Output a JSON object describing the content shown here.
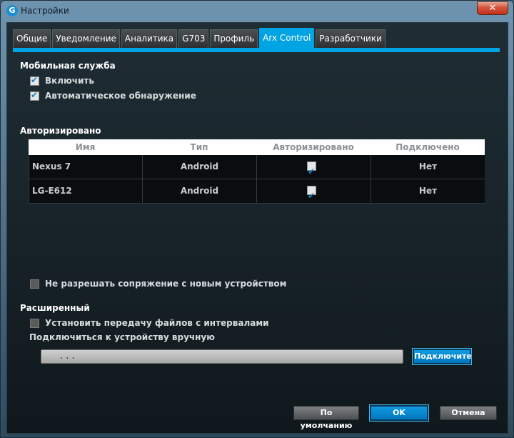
{
  "window": {
    "title": "Настройки",
    "icon": "G",
    "close_label": "✕"
  },
  "tabs": [
    {
      "label": "Общие"
    },
    {
      "label": "Уведомление"
    },
    {
      "label": "Аналитика"
    },
    {
      "label": "G703"
    },
    {
      "label": "Профиль"
    },
    {
      "label": "Arx Control",
      "active": true
    },
    {
      "label": "Разработчики"
    }
  ],
  "mobile_service": {
    "heading": "Мобильная служба",
    "enable": {
      "label": "Включить",
      "checked": true
    },
    "auto_detect": {
      "label": "Автоматическое обнаружение",
      "checked": true
    }
  },
  "authorized": {
    "heading": "Авторизировано",
    "columns": [
      "Имя",
      "Тип",
      "Авторизировано",
      "Подключено"
    ],
    "rows": [
      {
        "name": "Nexus 7",
        "type": "Android",
        "authorized": true,
        "connected": "Нет"
      },
      {
        "name": "LG-E612",
        "type": "Android",
        "authorized": true,
        "connected": "Нет"
      }
    ]
  },
  "no_pairing": {
    "label": "Не разрешать сопряжение с новым устройством",
    "checked": false
  },
  "advanced": {
    "heading": "Расширенный",
    "interval_transfer": {
      "label": "Установить передачу файлов с интервалами",
      "checked": false
    },
    "manual_connect_label": "Подключиться к устройству вручную",
    "ip_value": ". . .",
    "connect_button": "Подключите"
  },
  "footer": {
    "default_button": "По умолчанию",
    "ok_button": "OK",
    "cancel_button": "Отмена"
  },
  "colors": {
    "accent": "#00a4e2",
    "background": "#172228"
  }
}
